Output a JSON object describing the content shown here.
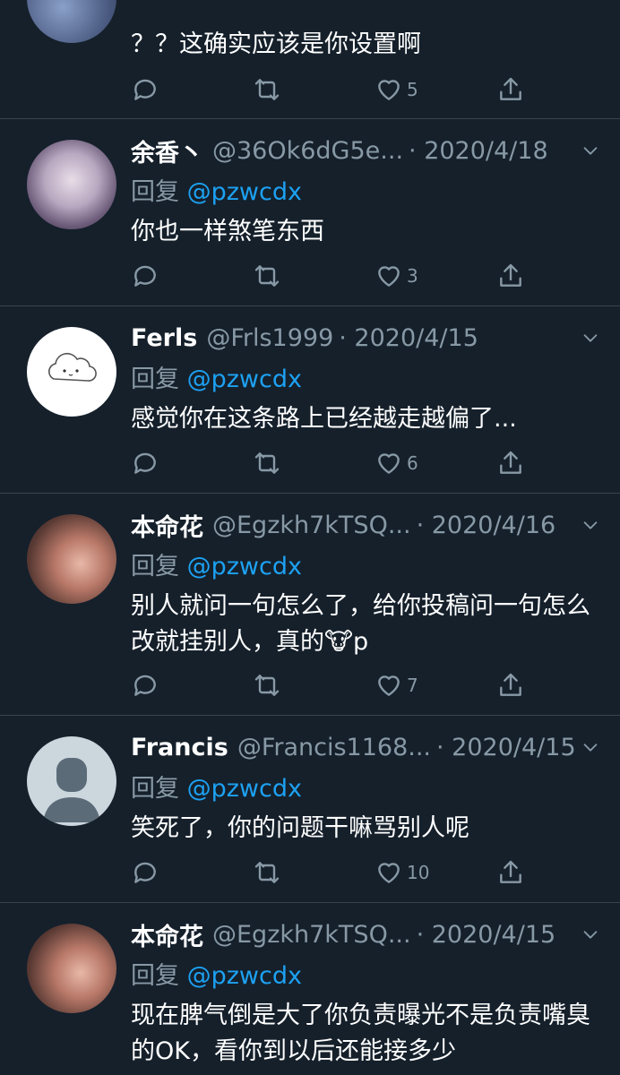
{
  "tweets": [
    {
      "body": "？？这确实应该是你设置啊",
      "likes": "5"
    },
    {
      "name": "余香丶",
      "handle": "@36Ok6dG5e...",
      "date": "· 2020/4/18",
      "reply_prefix": "回复",
      "reply_to": "@pzwcdx",
      "body": "你也一样煞笔东西",
      "likes": "3"
    },
    {
      "name": "Ferls",
      "handle": "@Frls1999",
      "date": "· 2020/4/15",
      "reply_prefix": "回复",
      "reply_to": "@pzwcdx",
      "body": "感觉你在这条路上已经越走越偏了...",
      "likes": "6"
    },
    {
      "name": "本命花",
      "handle": "@Egzkh7kTSQ...",
      "date": "· 2020/4/16",
      "reply_prefix": "回复",
      "reply_to": "@pzwcdx",
      "body": "别人就问一句怎么了，给你投稿问一句怎么改就挂别人，真的🐮p",
      "likes": "7"
    },
    {
      "name": "Francis",
      "handle": "@Francis1168...",
      "date": "· 2020/4/15",
      "reply_prefix": "回复",
      "reply_to": "@pzwcdx",
      "body": "笑死了，你的问题干嘛骂别人呢",
      "likes": "10"
    },
    {
      "name": "本命花",
      "handle": "@Egzkh7kTSQ...",
      "date": "· 2020/4/15",
      "reply_prefix": "回复",
      "reply_to": "@pzwcdx",
      "body": "现在脾气倒是大了你负责曝光不是负责嘴臭的OK，看你到以后还能接多少",
      "likes": ""
    }
  ],
  "icons": {
    "reply": "reply-icon",
    "retweet": "retweet-icon",
    "like": "like-icon",
    "share": "share-icon",
    "more": "chevron-down-icon"
  },
  "colors": {
    "background": "#15202b",
    "secondary_text": "#8899a6",
    "link": "#1da1f2",
    "divider": "#38444d"
  }
}
